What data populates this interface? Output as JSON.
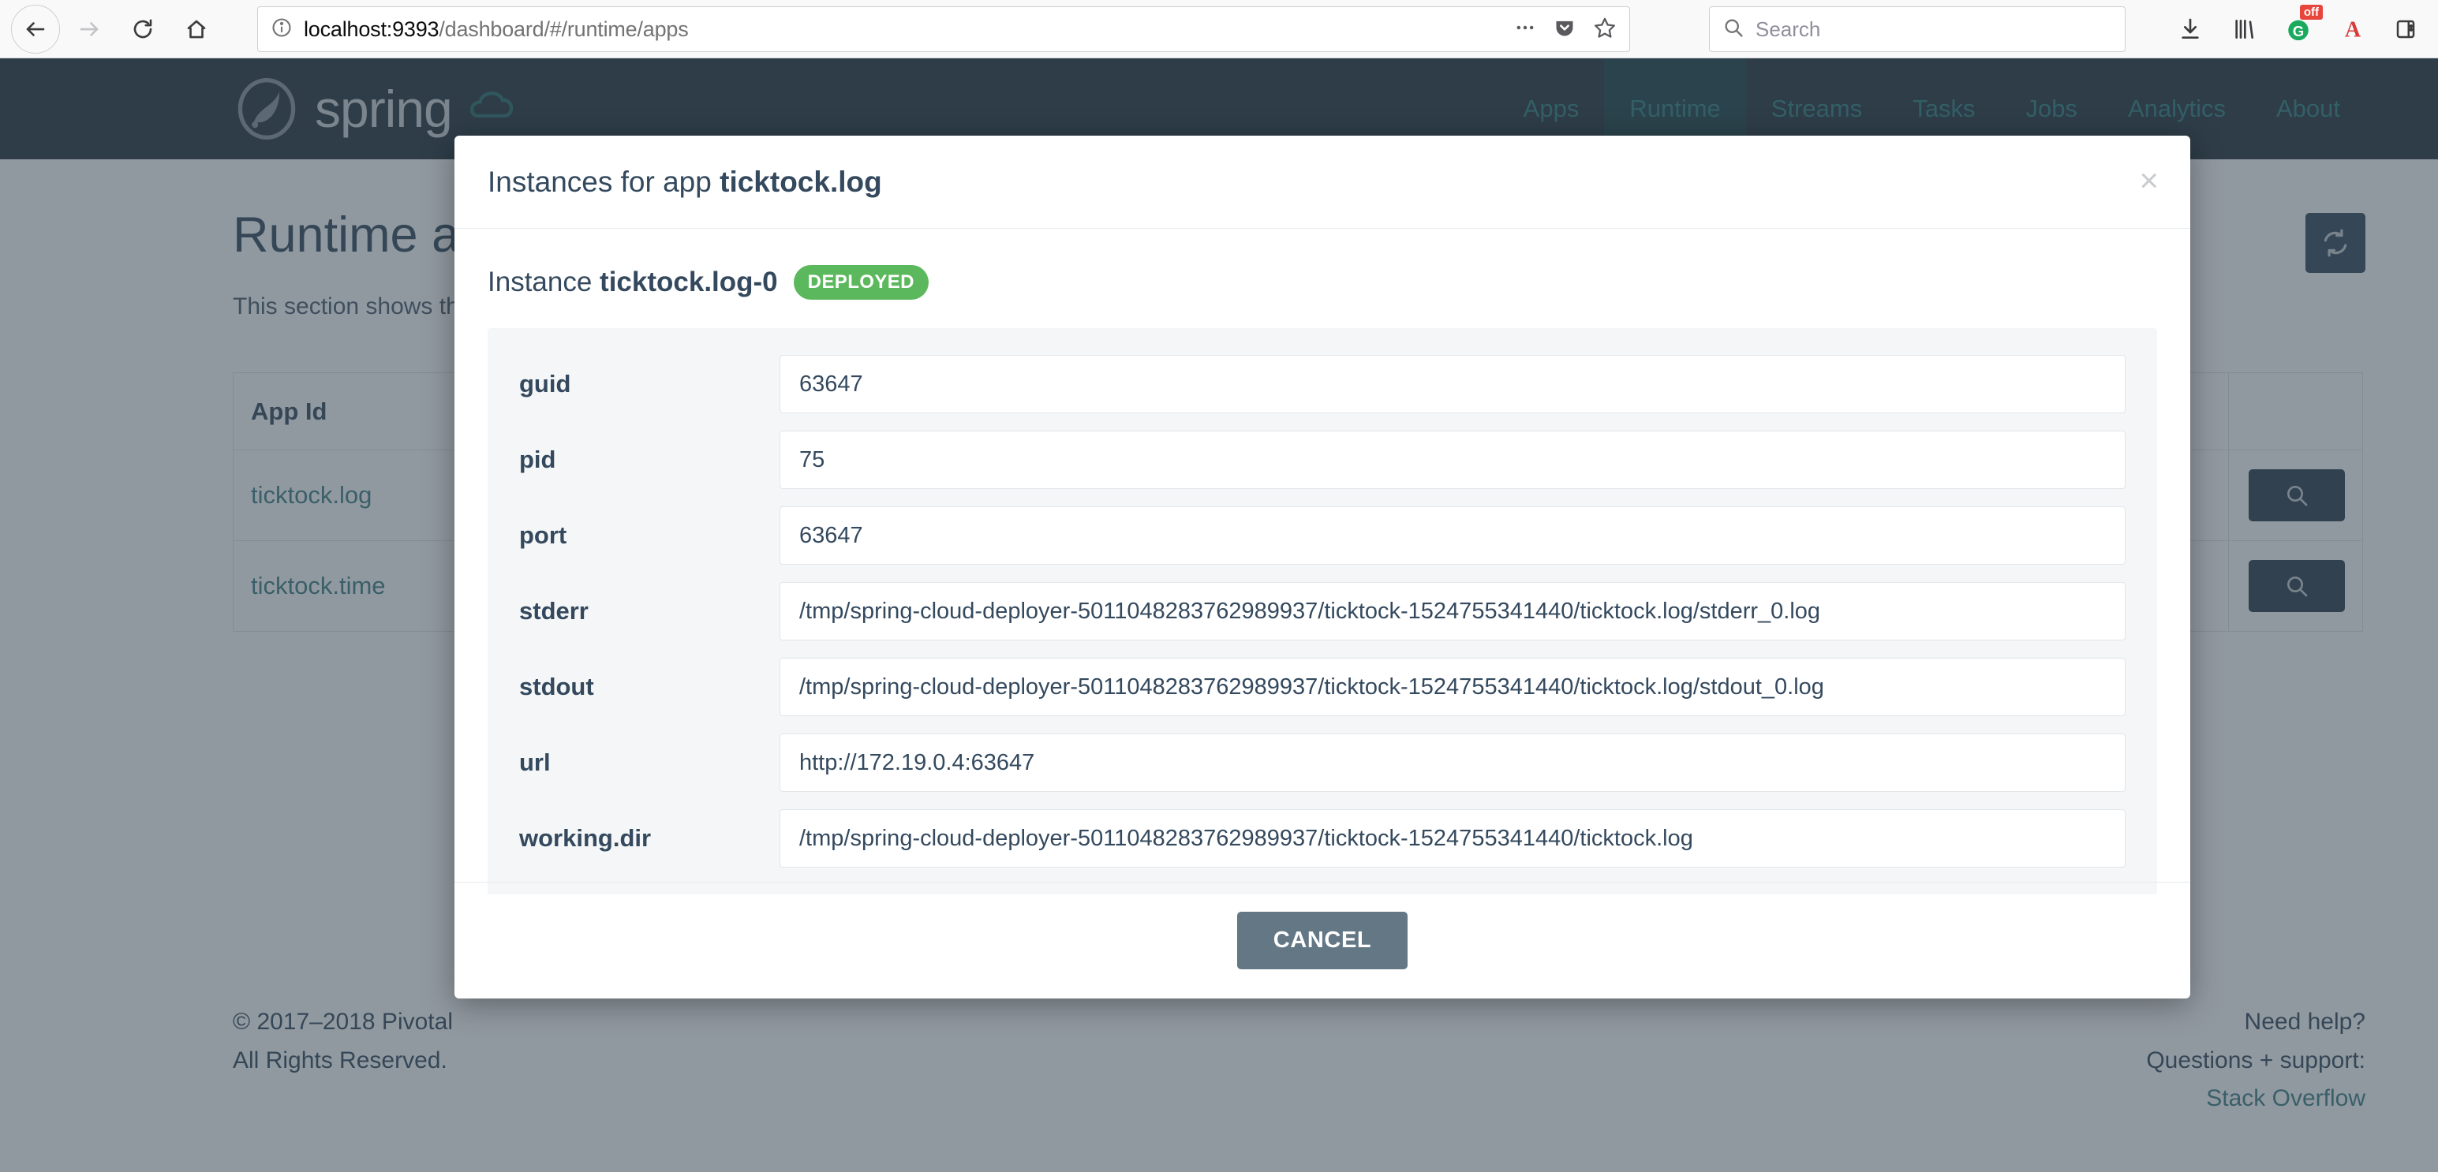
{
  "browser": {
    "url_host": "localhost:9393",
    "url_path": "/dashboard/#/runtime/apps",
    "search_placeholder": "Search",
    "icons": {
      "back": "back-arrow-icon",
      "forward": "forward-arrow-icon",
      "reload": "reload-icon",
      "home": "home-icon",
      "info": "info-circle-icon",
      "more": "page-actions-icon",
      "pocket": "pocket-icon",
      "bookmark": "star-icon",
      "search": "search-icon",
      "downloads": "download-icon",
      "library": "library-icon",
      "addon": "addon-icon",
      "adblock_badge": "off",
      "reader": "reader-font-icon",
      "sidebar": "sidebar-icon"
    }
  },
  "site": {
    "brand": "spring",
    "nav": [
      {
        "label": "Apps",
        "active": false
      },
      {
        "label": "Runtime",
        "active": true
      },
      {
        "label": "Streams",
        "active": false
      },
      {
        "label": "Tasks",
        "active": false
      },
      {
        "label": "Jobs",
        "active": false
      },
      {
        "label": "Analytics",
        "active": false
      },
      {
        "label": "About",
        "active": false
      }
    ]
  },
  "page": {
    "title": "Runtime apps",
    "subtitle": "This section shows the runtime applications.",
    "refresh_label": "refresh-icon",
    "table": {
      "columns": [
        "App Id",
        "",
        "",
        ""
      ],
      "rows": [
        {
          "app_id": "ticktock.log",
          "action": "search-icon"
        },
        {
          "app_id": "ticktock.time",
          "action": "search-icon"
        }
      ]
    }
  },
  "footer": {
    "copyright": "© 2017–2018 Pivotal",
    "rights": "All Rights Reserved.",
    "pivotal_link": "Pivotal",
    "help_title": "Need help?",
    "help_line": "Questions + support:",
    "help_link": "Stack Overflow"
  },
  "modal": {
    "title_prefix": "Instances for app ",
    "title_app": "ticktock.log",
    "close_label": "×",
    "instance_prefix": "Instance ",
    "instance_name": "ticktock.log-0",
    "status_badge": "DEPLOYED",
    "status_color": "#5cb85c",
    "cancel_label": "CANCEL",
    "fields": [
      {
        "label": "guid",
        "value": "63647"
      },
      {
        "label": "pid",
        "value": "75"
      },
      {
        "label": "port",
        "value": "63647"
      },
      {
        "label": "stderr",
        "value": "/tmp/spring-cloud-deployer-5011048283762989937/ticktock-1524755341440/ticktock.log/stderr_0.log"
      },
      {
        "label": "stdout",
        "value": "/tmp/spring-cloud-deployer-5011048283762989937/ticktock-1524755341440/ticktock.log/stdout_0.log"
      },
      {
        "label": "url",
        "value": "http://172.19.0.4:63647"
      },
      {
        "label": "working.dir",
        "value": "/tmp/spring-cloud-deployer-5011048283762989937/ticktock-1524755341440/ticktock.log"
      }
    ]
  }
}
